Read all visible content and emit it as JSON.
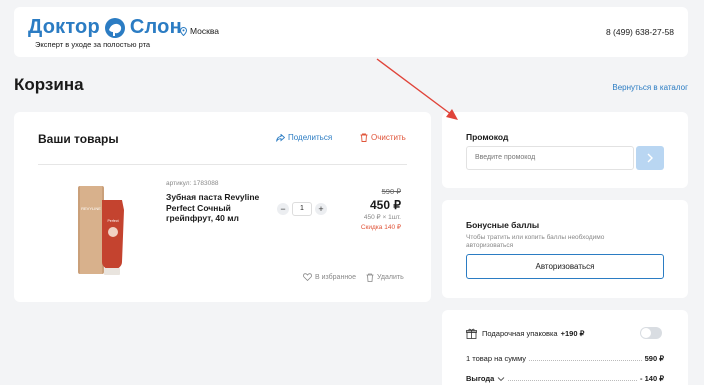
{
  "header": {
    "logo_left": "Доктор",
    "logo_right": "Слон",
    "tagline": "Эксперт в уходе за полостью рта",
    "city": "Москва",
    "phone": "8 (499) 638-27-58"
  },
  "page": {
    "title": "Корзина",
    "back_link": "Вернуться в каталог"
  },
  "cart": {
    "heading": "Ваши товары",
    "share_label": "Поделиться",
    "clear_label": "Очистить",
    "item": {
      "sku": "артикул: 1783088",
      "name": "Зубная паста Revyline Perfect Сочный грейпфрут, 40 мл",
      "qty_minus": "−",
      "quantity": "1",
      "qty_plus": "+",
      "old_price": "590 ₽",
      "price": "450 ₽",
      "unit_price": "450 ₽ × 1шт.",
      "discount": "Скидка 140 ₽",
      "favorite_label": "В избранное",
      "delete_label": "Удалить"
    }
  },
  "promo": {
    "title": "Промокод",
    "placeholder": "Введите промокод"
  },
  "bonus": {
    "title": "Бонусные баллы",
    "note": "Чтобы тратить или копить баллы необходимо авторизоваться",
    "button": "Авторизоваться"
  },
  "summary": {
    "gift_label": "Подарочная упаковка",
    "gift_price": "+190 ₽",
    "gift_enabled": false,
    "items_label": "1 товар на сумму",
    "items_value": "590 ₽",
    "benefit_label": "Выгода",
    "benefit_value": "- 140 ₽"
  },
  "colors": {
    "accent": "#2b7cc3",
    "danger": "#e0553a",
    "annotation_arrow": "#e0443a"
  }
}
